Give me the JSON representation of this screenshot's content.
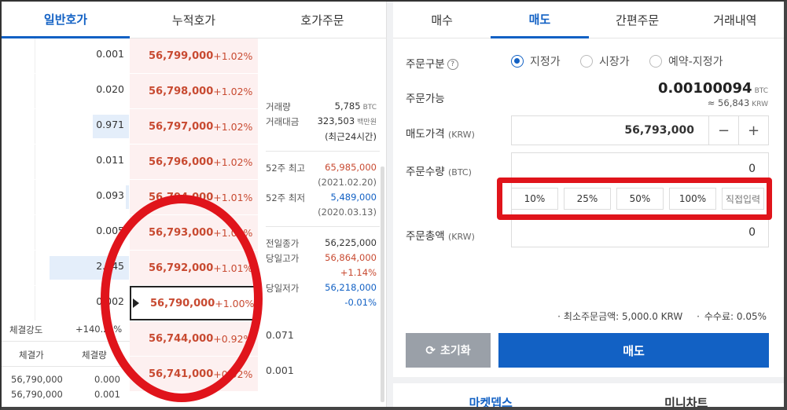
{
  "left_tabs": [
    "일반호가",
    "누적호가",
    "호가주문"
  ],
  "orderbook": [
    {
      "qty": "0.001",
      "bar": 0.0,
      "price": "56,799,000",
      "pct": "+1.02%"
    },
    {
      "qty": "0.020",
      "bar": 0.0,
      "price": "56,798,000",
      "pct": "+1.02%"
    },
    {
      "qty": "0.971",
      "bar": 0.42,
      "price": "56,797,000",
      "pct": "+1.02%"
    },
    {
      "qty": "0.011",
      "bar": 0.0,
      "price": "56,796,000",
      "pct": "+1.02%"
    },
    {
      "qty": "0.093",
      "bar": 0.04,
      "price": "56,794,000",
      "pct": "+1.01%"
    },
    {
      "qty": "0.005",
      "bar": 0.0,
      "price": "56,793,000",
      "pct": "+1.01%"
    },
    {
      "qty": "2.445",
      "bar": 0.92,
      "price": "56,792,000",
      "pct": "+1.01%"
    },
    {
      "qty": "0.002",
      "bar": 0.0,
      "price": "56,790,000",
      "pct": "+1.00%"
    },
    {
      "qty": "",
      "bar": 0.0,
      "price": "56,744,000",
      "pct": "+0.92%"
    },
    {
      "qty": "",
      "bar": 0.0,
      "price": "56,741,000",
      "pct": "+0.92%"
    }
  ],
  "bid_qty": [
    "0.071",
    "0.001"
  ],
  "stats": {
    "volume_label": "거래량",
    "volume_value": "5,785",
    "volume_unit": "BTC",
    "amount_label": "거래대금",
    "amount_value": "323,503",
    "amount_unit": "백만원",
    "period": "(최근24시간)",
    "high52_label": "52주 최고",
    "high52_value": "65,985,000",
    "high52_date": "(2021.02.20)",
    "low52_label": "52주 최저",
    "low52_value": "5,489,000",
    "low52_date": "(2020.03.13)",
    "prev_close_label": "전일종가",
    "prev_close_value": "56,225,000",
    "day_high_label": "당일고가",
    "day_high_value": "56,864,000",
    "day_high_pct": "+1.14%",
    "day_low_label": "당일저가",
    "day_low_value": "56,218,000",
    "day_low_pct": "-0.01%"
  },
  "strength_label": "체결강도",
  "strength_value": "+140.2_%",
  "trade_headers": [
    "체결가",
    "체결량"
  ],
  "trades": [
    {
      "price": "56,790,000",
      "qty": "0.000"
    },
    {
      "price": "56,790,000",
      "qty": "0.001"
    }
  ],
  "right_tabs": [
    "매수",
    "매도",
    "간편주문",
    "거래내역"
  ],
  "order": {
    "type_label": "주문구분",
    "types": [
      "지정가",
      "시장가",
      "예약-지정가"
    ],
    "available_label": "주문가능",
    "available_value": "0.00100094",
    "available_unit": "BTC",
    "available_krw": "≈ 56,843",
    "available_krw_unit": "KRW",
    "price_label": "매도가격",
    "price_unit": "(KRW)",
    "price_value": "56,793,000",
    "qty_label": "주문수량",
    "qty_unit": "(BTC)",
    "qty_value": "0",
    "pct_buttons": [
      "10%",
      "25%",
      "50%",
      "100%",
      "직접입력"
    ],
    "total_label": "주문총액",
    "total_unit": "(KRW)",
    "total_value": "0",
    "min_order": "최소주문금액: 5,000.0 KRW",
    "fee": "수수료: 0.05%",
    "reset_label": "초기화",
    "sell_label": "매도",
    "minus": "−",
    "plus": "+"
  },
  "bottom_tabs": [
    "마켓뎁스",
    "미니차트"
  ]
}
